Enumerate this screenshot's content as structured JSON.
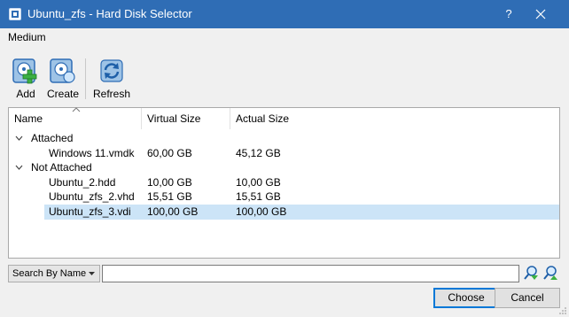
{
  "window": {
    "title": "Ubuntu_zfs - Hard Disk Selector",
    "help_label": "?",
    "titlebar_color": "#2f6db5"
  },
  "menu": {
    "medium": "Medium"
  },
  "toolbar": {
    "add": {
      "label": "Add",
      "icon": "add-disk-icon"
    },
    "create": {
      "label": "Create",
      "icon": "create-disk-icon"
    },
    "refresh": {
      "label": "Refresh",
      "icon": "refresh-icon"
    }
  },
  "tree": {
    "columns": [
      "Name",
      "Virtual Size",
      "Actual Size"
    ],
    "groups": [
      {
        "label": "Attached",
        "items": [
          {
            "name": "Windows 11.vmdk",
            "virtual_size": "60,00 GB",
            "actual_size": "45,12 GB"
          }
        ]
      },
      {
        "label": "Not Attached",
        "items": [
          {
            "name": "Ubuntu_2.hdd",
            "virtual_size": "10,00 GB",
            "actual_size": "10,00 GB"
          },
          {
            "name": "Ubuntu_zfs_2.vhd",
            "virtual_size": "15,51 GB",
            "actual_size": "15,51 GB"
          },
          {
            "name": "Ubuntu_zfs_3.vdi",
            "virtual_size": "100,00 GB",
            "actual_size": "100,00 GB",
            "selected": true
          }
        ]
      }
    ],
    "selection_color": "#cce4f7"
  },
  "search": {
    "mode": "Search By Name",
    "value": "",
    "prev_icon": "search-previous-icon",
    "next_icon": "search-next-icon"
  },
  "buttons": {
    "choose": "Choose",
    "cancel": "Cancel"
  }
}
